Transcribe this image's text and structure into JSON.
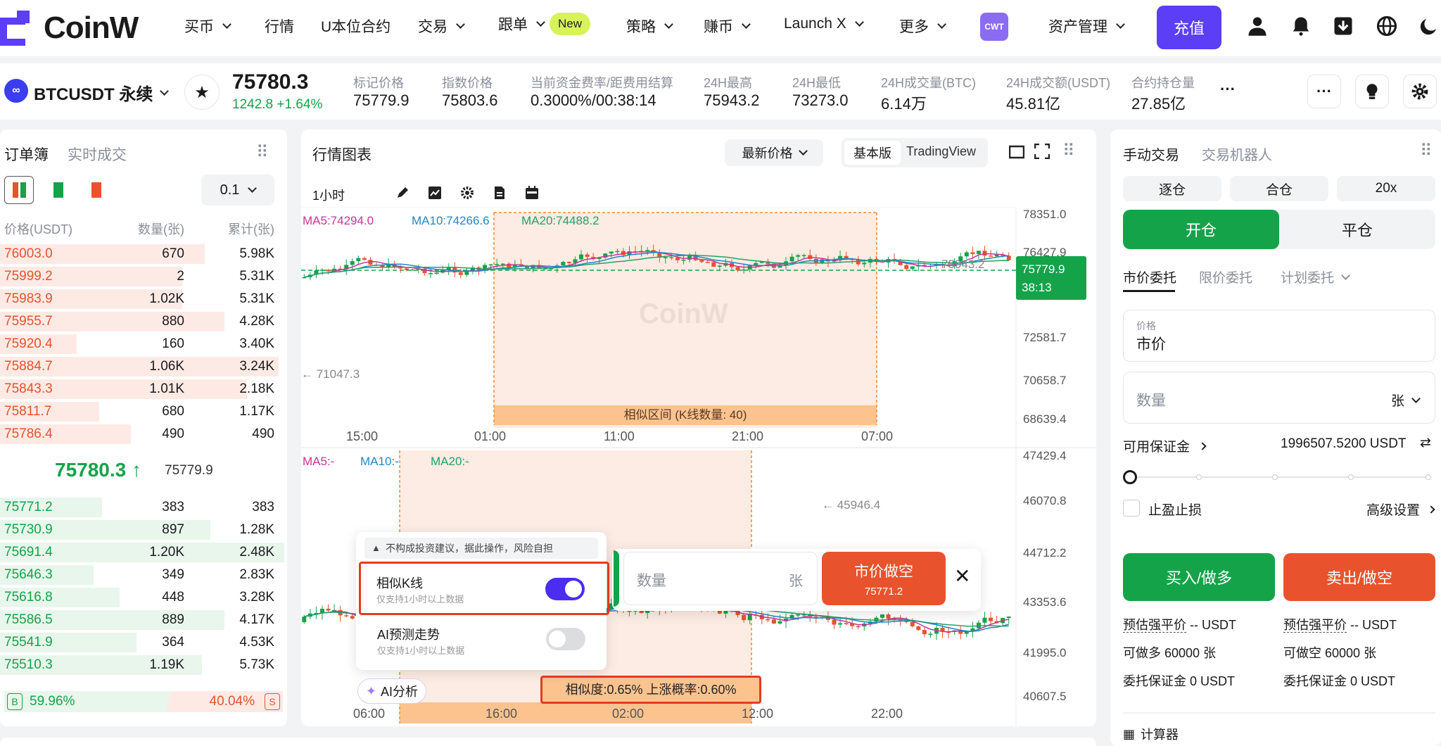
{
  "nav": {
    "brand": "CoinW",
    "items": [
      {
        "label": "买币",
        "chevron": true
      },
      {
        "label": "行情",
        "chevron": false
      },
      {
        "label": "U本位合约",
        "chevron": false
      },
      {
        "label": "交易",
        "chevron": true
      },
      {
        "label": "跟单",
        "chevron": true,
        "badge": "New"
      },
      {
        "label": "策略",
        "chevron": true
      },
      {
        "label": "赚币",
        "chevron": true
      },
      {
        "label": "Launch X",
        "chevron": true
      },
      {
        "label": "更多",
        "chevron": true
      }
    ],
    "asset_mgmt": "资产管理",
    "deposit": "充值",
    "cwt_badge": "CWT",
    "icons": [
      "user-icon",
      "bell-icon",
      "download-icon",
      "globe-icon",
      "moon-icon"
    ]
  },
  "ticker": {
    "symbol": "BTCUSDT 永续",
    "price": "75780.3",
    "change": "1242.8 +1.64%",
    "stats": [
      {
        "label": "标记价格",
        "value": "75779.9"
      },
      {
        "label": "指数价格",
        "value": "75803.6"
      },
      {
        "label": "当前资金费率/距费用结算",
        "value": "0.3000%/00:38:14"
      },
      {
        "label": "24H最高",
        "value": "75943.2"
      },
      {
        "label": "24H最低",
        "value": "73273.0"
      },
      {
        "label": "24H成交量(BTC)",
        "value": "6.14万"
      },
      {
        "label": "24H成交额(USDT)",
        "value": "45.81亿"
      },
      {
        "label": "合约持仓量",
        "value": "27.85亿"
      }
    ],
    "more": "···"
  },
  "orderbook": {
    "tabs": [
      "订单簿",
      "实时成交"
    ],
    "precision": "0.1",
    "headers": [
      "价格(USDT)",
      "数量(张)",
      "累计(张)"
    ],
    "asks": [
      {
        "price": "76003.0",
        "qty": "670",
        "cum": "5.98K",
        "depth": 0.72
      },
      {
        "price": "75999.2",
        "qty": "2",
        "cum": "5.31K",
        "depth": 0.64
      },
      {
        "price": "75983.9",
        "qty": "1.02K",
        "cum": "5.31K",
        "depth": 0.64
      },
      {
        "price": "75955.7",
        "qty": "880",
        "cum": "4.28K",
        "depth": 0.79
      },
      {
        "price": "75920.4",
        "qty": "160",
        "cum": "3.40K",
        "depth": 0.27
      },
      {
        "price": "75884.7",
        "qty": "1.06K",
        "cum": "3.24K",
        "depth": 0.98
      },
      {
        "price": "75843.3",
        "qty": "1.01K",
        "cum": "2.18K",
        "depth": 0.87
      },
      {
        "price": "75811.7",
        "qty": "680",
        "cum": "1.17K",
        "depth": 0.35
      },
      {
        "price": "75786.4",
        "qty": "490",
        "cum": "490",
        "depth": 0.46
      }
    ],
    "mid_price": "75780.3",
    "mid_arrow": "↑",
    "mark_price": "75779.9",
    "bids": [
      {
        "price": "75771.2",
        "qty": "383",
        "cum": "383",
        "depth": 0.36
      },
      {
        "price": "75730.9",
        "qty": "897",
        "cum": "1.28K",
        "depth": 0.74
      },
      {
        "price": "75691.4",
        "qty": "1.20K",
        "cum": "2.48K",
        "depth": 1.0
      },
      {
        "price": "75646.3",
        "qty": "349",
        "cum": "2.83K",
        "depth": 0.33
      },
      {
        "price": "75616.8",
        "qty": "448",
        "cum": "3.28K",
        "depth": 0.42
      },
      {
        "price": "75586.5",
        "qty": "889",
        "cum": "4.17K",
        "depth": 0.79
      },
      {
        "price": "75541.9",
        "qty": "364",
        "cum": "4.53K",
        "depth": 0.48
      },
      {
        "price": "75510.3",
        "qty": "1.19K",
        "cum": "5.73K",
        "depth": 0.71
      }
    ],
    "buy_label": "B",
    "buy_ratio": "59.96%",
    "sell_ratio": "40.04%",
    "sell_label": "S"
  },
  "chart": {
    "title": "行情图表",
    "price_type": "最新价格",
    "mode_basic": "基本版",
    "mode_tv": "TradingView",
    "interval": "1小时",
    "ma5": "MA5:74294.0",
    "ma10": "MA10:74266.6",
    "ma20": "MA20:74488.2",
    "y_ticks": [
      "78351.0",
      "76427.9",
      "72581.7",
      "70658.7",
      "68639.4"
    ],
    "high_marker": "75943.2",
    "low_marker": "← 71047.3",
    "last_price": "75779.9",
    "countdown": "38:13",
    "watermark": "CoinW",
    "similar_range": "相似区间 (K线数量: 40)",
    "x_ticks": [
      "15:00",
      "01:00",
      "11:00",
      "21:00",
      "07:00"
    ],
    "lower": {
      "ma5": "MA5:-",
      "ma10": "MA10:-",
      "ma20": "MA20:-",
      "y_ticks": [
        "47429.4",
        "46070.8",
        "44712.2",
        "43353.6",
        "41995.0",
        "40607.5"
      ],
      "high_marker": "← 45946.4",
      "x_ticks": [
        "06:00",
        "16:00",
        "02:00",
        "12:00",
        "22:00"
      ],
      "similarity": "相似度:0.65% 上涨概率:0.60%"
    },
    "ai_popup": {
      "disclaimer": "不构成投资建议，据此操作，风险自担",
      "opt1_title": "相似K线",
      "opt1_sub": "仅支持1小时以上数据",
      "opt2_title": "AI预测走势",
      "opt2_sub": "仅支持1小时以上数据",
      "ai_button": "AI分析"
    },
    "quick_order": {
      "qty_placeholder": "数量",
      "unit": "张",
      "btn_title": "市价做空",
      "btn_price": "75771.2"
    }
  },
  "trade": {
    "tabs": [
      "手动交易",
      "交易机器人"
    ],
    "margin_modes": [
      "逐仓",
      "合仓",
      "20x"
    ],
    "open": "开仓",
    "close": "平仓",
    "order_types": [
      "市价委托",
      "限价委托",
      "计划委托"
    ],
    "price_label": "价格",
    "price_value": "市价",
    "qty_placeholder": "数量",
    "qty_unit": "张",
    "avail_label": "可用保证金",
    "avail_value": "1996507.5200 USDT",
    "tp_sl": "止盈止损",
    "advanced": "高级设置",
    "buy_btn": "买入/做多",
    "sell_btn": "卖出/做空",
    "buy_info": [
      {
        "label": "预估强平价",
        "value": "-- USDT"
      },
      {
        "label": "可做多",
        "value": "60000 张"
      },
      {
        "label": "委托保证金",
        "value": "0 USDT"
      }
    ],
    "sell_info": [
      {
        "label": "预估强平价",
        "value": "-- USDT"
      },
      {
        "label": "可做空",
        "value": "60000 张"
      },
      {
        "label": "委托保证金",
        "value": "0 USDT"
      }
    ],
    "calculator": "计算器"
  },
  "colors": {
    "brand": "#5b3ef6",
    "up": "#15a34a",
    "down": "#e8532e"
  }
}
